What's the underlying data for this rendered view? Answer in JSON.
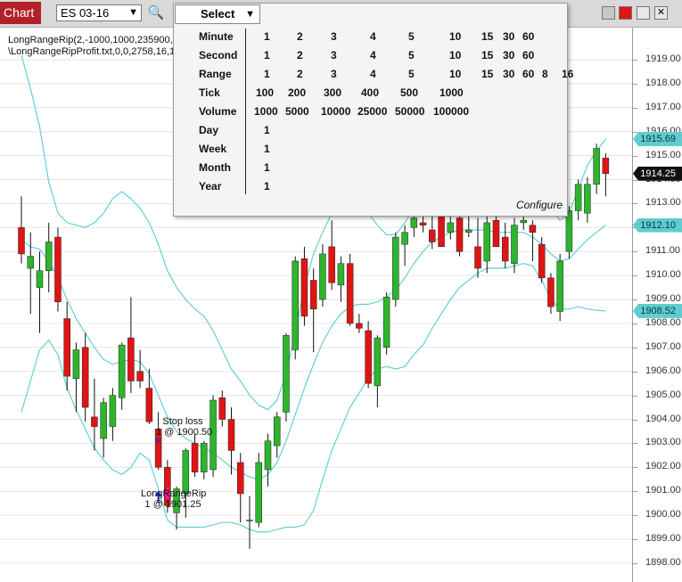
{
  "toolbar": {
    "chart_tab": "Chart",
    "instrument": "ES 03-16",
    "icons": [
      "search-icon",
      "bar-style-icon",
      "pencil-icon",
      "zoom-in-icon",
      "zoom-out-icon",
      "pointer-icon",
      "data-box-icon",
      "properties-icon",
      "strategies-icon",
      "indicators-icon",
      "reload-icon",
      "menu-icon"
    ],
    "window_buttons": [
      "minimize-icon",
      "close-red-icon",
      "maximize-icon",
      "close-icon"
    ],
    "accent": "#b3202a"
  },
  "interval_menu": {
    "select_label": "Select",
    "rows": [
      {
        "label": "Minute",
        "values": [
          "1",
          "2",
          "3",
          "4",
          "5",
          "10",
          "15",
          "30",
          "60"
        ]
      },
      {
        "label": "Second",
        "values": [
          "1",
          "2",
          "3",
          "4",
          "5",
          "10",
          "15",
          "30",
          "60"
        ]
      },
      {
        "label": "Range",
        "values": [
          "1",
          "2",
          "3",
          "4",
          "5",
          "10",
          "15",
          "30",
          "60",
          "8",
          "16"
        ]
      },
      {
        "label": "Tick",
        "values": [
          "100",
          "200",
          "300",
          "400",
          "500",
          "1000"
        ]
      },
      {
        "label": "Volume",
        "values": [
          "1000",
          "5000",
          "10000",
          "25000",
          "50000",
          "100000"
        ]
      },
      {
        "label": "Day",
        "values": [
          "1"
        ]
      },
      {
        "label": "Week",
        "values": [
          "1"
        ]
      },
      {
        "label": "Month",
        "values": [
          "1"
        ]
      },
      {
        "label": "Year",
        "values": [
          "1"
        ]
      }
    ],
    "configure_label": "Configure"
  },
  "chart_labels": {
    "strategy": "LongRangeRip(2,-1000,1000,235900,12",
    "file": "\\LongRangeRipProfit.txt,0,0,2758,16,15",
    "stop_label": "Stop loss",
    "stop_detail": "1 @ 1900.50",
    "entry_label": "LongRangeRip",
    "entry_detail": "1 @ 1901.25"
  },
  "price_axis": {
    "ticks": [
      "1919.00",
      "1918.00",
      "1917.00",
      "1916.00",
      "1915.00",
      "1914.00",
      "1913.00",
      "1912.00",
      "1911.00",
      "1910.00",
      "1909.00",
      "1908.00",
      "1907.00",
      "1906.00",
      "1905.00",
      "1904.00",
      "1903.00",
      "1902.00",
      "1901.00",
      "1900.00",
      "1899.00",
      "1898.00"
    ],
    "tags": [
      {
        "value": "1915.69",
        "price": 1915.69,
        "style": "cyan"
      },
      {
        "value": "1914.25",
        "price": 1914.25,
        "style": "black"
      },
      {
        "value": "1912.10",
        "price": 1912.1,
        "style": "cyan"
      },
      {
        "value": "1908.52",
        "price": 1908.52,
        "style": "cyan"
      }
    ]
  },
  "chart_data": {
    "type": "candlestick",
    "colors": {
      "up": "#2db52d",
      "down": "#e01414",
      "bands": "#66cfd2",
      "entry_arrow": "#1a2fd6",
      "exit_arrow": "#e020d8"
    },
    "ylim": [
      1897.8,
      1919.6
    ],
    "candles": [
      {
        "o": 1912.0,
        "h": 1913.3,
        "l": 1910.5,
        "c": 1910.9
      },
      {
        "o": 1910.3,
        "h": 1911.8,
        "l": 1908.4,
        "c": 1910.8
      },
      {
        "o": 1909.5,
        "h": 1911.0,
        "l": 1907.6,
        "c": 1910.2
      },
      {
        "o": 1910.2,
        "h": 1912.2,
        "l": 1909.3,
        "c": 1911.4
      },
      {
        "o": 1911.6,
        "h": 1912.0,
        "l": 1908.5,
        "c": 1908.9
      },
      {
        "o": 1908.2,
        "h": 1908.9,
        "l": 1905.2,
        "c": 1905.8
      },
      {
        "o": 1905.7,
        "h": 1907.2,
        "l": 1904.3,
        "c": 1906.9
      },
      {
        "o": 1907.0,
        "h": 1907.6,
        "l": 1903.9,
        "c": 1904.5
      },
      {
        "o": 1904.1,
        "h": 1905.7,
        "l": 1902.7,
        "c": 1903.7
      },
      {
        "o": 1903.2,
        "h": 1904.9,
        "l": 1902.4,
        "c": 1904.7
      },
      {
        "o": 1903.7,
        "h": 1905.3,
        "l": 1903.1,
        "c": 1905.0
      },
      {
        "o": 1904.9,
        "h": 1907.2,
        "l": 1904.4,
        "c": 1907.1
      },
      {
        "o": 1907.4,
        "h": 1909.1,
        "l": 1905.1,
        "c": 1905.6
      },
      {
        "o": 1906.0,
        "h": 1906.9,
        "l": 1905.3,
        "c": 1905.6
      },
      {
        "o": 1905.3,
        "h": 1906.1,
        "l": 1903.8,
        "c": 1903.9
      },
      {
        "o": 1903.6,
        "h": 1904.3,
        "l": 1901.9,
        "c": 1902.0
      },
      {
        "o": 1902.0,
        "h": 1902.3,
        "l": 1900.1,
        "c": 1900.4
      },
      {
        "o": 1900.1,
        "h": 1901.2,
        "l": 1899.4,
        "c": 1901.1
      },
      {
        "o": 1900.9,
        "h": 1902.8,
        "l": 1899.9,
        "c": 1902.7
      },
      {
        "o": 1903.0,
        "h": 1903.4,
        "l": 1901.6,
        "c": 1901.8
      },
      {
        "o": 1901.8,
        "h": 1903.1,
        "l": 1901.5,
        "c": 1903.0
      },
      {
        "o": 1901.9,
        "h": 1905.0,
        "l": 1901.6,
        "c": 1904.8
      },
      {
        "o": 1904.9,
        "h": 1905.2,
        "l": 1903.7,
        "c": 1904.0
      },
      {
        "o": 1904.0,
        "h": 1904.5,
        "l": 1901.7,
        "c": 1902.7
      },
      {
        "o": 1902.2,
        "h": 1902.6,
        "l": 1899.7,
        "c": 1900.9
      },
      {
        "o": 1899.8,
        "h": 1900.8,
        "l": 1898.6,
        "c": 1899.8
      },
      {
        "o": 1899.7,
        "h": 1902.6,
        "l": 1899.5,
        "c": 1902.2
      },
      {
        "o": 1901.9,
        "h": 1903.4,
        "l": 1901.2,
        "c": 1903.1
      },
      {
        "o": 1902.9,
        "h": 1904.3,
        "l": 1902.4,
        "c": 1904.1
      },
      {
        "o": 1904.3,
        "h": 1907.6,
        "l": 1903.9,
        "c": 1907.5
      },
      {
        "o": 1906.9,
        "h": 1910.8,
        "l": 1906.5,
        "c": 1910.6
      },
      {
        "o": 1910.7,
        "h": 1911.2,
        "l": 1907.9,
        "c": 1908.3
      },
      {
        "o": 1909.8,
        "h": 1910.3,
        "l": 1906.8,
        "c": 1908.6
      },
      {
        "o": 1909.0,
        "h": 1911.3,
        "l": 1908.7,
        "c": 1910.9
      },
      {
        "o": 1911.2,
        "h": 1912.3,
        "l": 1909.4,
        "c": 1909.7
      },
      {
        "o": 1909.6,
        "h": 1910.8,
        "l": 1908.9,
        "c": 1910.5
      },
      {
        "o": 1910.5,
        "h": 1910.9,
        "l": 1907.9,
        "c": 1908.0
      },
      {
        "o": 1908.0,
        "h": 1908.4,
        "l": 1907.6,
        "c": 1907.8
      },
      {
        "o": 1907.7,
        "h": 1908.1,
        "l": 1905.3,
        "c": 1905.5
      },
      {
        "o": 1905.4,
        "h": 1907.5,
        "l": 1904.5,
        "c": 1907.4
      },
      {
        "o": 1907.0,
        "h": 1909.3,
        "l": 1906.7,
        "c": 1909.1
      },
      {
        "o": 1909.0,
        "h": 1911.8,
        "l": 1908.7,
        "c": 1911.6
      },
      {
        "o": 1911.3,
        "h": 1912.1,
        "l": 1910.4,
        "c": 1911.8
      },
      {
        "o": 1912.0,
        "h": 1913.4,
        "l": 1911.6,
        "c": 1912.4
      },
      {
        "o": 1912.2,
        "h": 1913.1,
        "l": 1911.8,
        "c": 1912.1
      },
      {
        "o": 1911.9,
        "h": 1913.0,
        "l": 1911.1,
        "c": 1911.4
      },
      {
        "o": 1912.6,
        "h": 1913.2,
        "l": 1911.2,
        "c": 1911.2
      },
      {
        "o": 1911.8,
        "h": 1913.6,
        "l": 1911.5,
        "c": 1912.2
      },
      {
        "o": 1912.4,
        "h": 1913.1,
        "l": 1910.8,
        "c": 1911.0
      },
      {
        "o": 1911.8,
        "h": 1913.5,
        "l": 1911.6,
        "c": 1911.9
      },
      {
        "o": 1911.2,
        "h": 1912.4,
        "l": 1909.9,
        "c": 1910.3
      },
      {
        "o": 1910.6,
        "h": 1912.5,
        "l": 1910.1,
        "c": 1912.2
      },
      {
        "o": 1912.3,
        "h": 1912.9,
        "l": 1911.2,
        "c": 1911.2
      },
      {
        "o": 1911.6,
        "h": 1912.2,
        "l": 1910.3,
        "c": 1910.6
      },
      {
        "o": 1910.5,
        "h": 1912.4,
        "l": 1910.1,
        "c": 1912.1
      },
      {
        "o": 1912.2,
        "h": 1913.2,
        "l": 1911.9,
        "c": 1912.3
      },
      {
        "o": 1912.1,
        "h": 1912.3,
        "l": 1910.6,
        "c": 1911.8
      },
      {
        "o": 1911.3,
        "h": 1911.6,
        "l": 1909.7,
        "c": 1909.9
      },
      {
        "o": 1909.9,
        "h": 1910.1,
        "l": 1908.4,
        "c": 1908.7
      },
      {
        "o": 1908.5,
        "h": 1910.9,
        "l": 1908.1,
        "c": 1910.6
      },
      {
        "o": 1911.0,
        "h": 1912.9,
        "l": 1910.7,
        "c": 1912.7
      },
      {
        "o": 1912.7,
        "h": 1914.0,
        "l": 1912.3,
        "c": 1913.8
      },
      {
        "o": 1912.6,
        "h": 1914.1,
        "l": 1912.2,
        "c": 1913.8
      },
      {
        "o": 1913.8,
        "h": 1915.5,
        "l": 1913.4,
        "c": 1915.3
      },
      {
        "o": 1914.9,
        "h": 1915.1,
        "l": 1913.3,
        "c": 1914.25
      }
    ],
    "bands": {
      "upper": [
        1919.2,
        1917.8,
        1916.2,
        1913.9,
        1912.6,
        1912.2,
        1912.1,
        1912.0,
        1912.2,
        1912.6,
        1913.2,
        1913.5,
        1913.2,
        1912.8,
        1912.2,
        1911.3,
        1910.2,
        1909.5,
        1909.0,
        1908.6,
        1908.3,
        1907.7,
        1906.9,
        1906.1,
        1905.6,
        1905.0,
        1904.6,
        1904.4,
        1904.8,
        1905.9,
        1907.6,
        1909.5,
        1910.9,
        1911.8,
        1912.6,
        1913.1,
        1913.3,
        1913.1,
        1912.6,
        1912.1,
        1911.7,
        1911.7,
        1912.2,
        1912.8,
        1913.4,
        1913.9,
        1914.1,
        1914.3,
        1914.3,
        1914.2,
        1914.1,
        1914.0,
        1913.9,
        1913.8,
        1913.8,
        1913.7,
        1913.6,
        1913.3,
        1912.8,
        1912.3,
        1912.6,
        1913.6,
        1914.6,
        1915.2,
        1915.69
      ],
      "lower": [
        1904.3,
        1905.6,
        1906.9,
        1907.3,
        1906.7,
        1905.3,
        1904.4,
        1903.6,
        1902.8,
        1902.3,
        1901.9,
        1901.7,
        1902.0,
        1902.6,
        1902.3,
        1901.1,
        1899.8,
        1899.5,
        1899.5,
        1899.5,
        1899.5,
        1899.6,
        1899.7,
        1899.7,
        1899.6,
        1899.4,
        1899.3,
        1899.3,
        1899.4,
        1899.5,
        1899.5,
        1899.6,
        1900.2,
        1901.5,
        1902.7,
        1903.6,
        1904.5,
        1905.1,
        1905.7,
        1906.1,
        1906.2,
        1906.1,
        1906.2,
        1906.7,
        1907.1,
        1907.8,
        1908.4,
        1909.0,
        1909.5,
        1909.8,
        1910.1,
        1910.3,
        1910.3,
        1910.3,
        1910.4,
        1910.5,
        1910.4,
        1909.8,
        1909.0,
        1908.6,
        1908.6,
        1908.7,
        1908.6,
        1908.55,
        1908.52
      ],
      "middle": [
        1911.5,
        1911.2,
        1911.1,
        1910.6,
        1909.9,
        1909.0,
        1908.2,
        1907.6,
        1907.0,
        1906.5,
        1906.3,
        1906.4,
        1906.5,
        1906.4,
        1905.9,
        1905.0,
        1904.1,
        1903.5,
        1903.2,
        1903.0,
        1902.8,
        1902.6,
        1902.3,
        1902.0,
        1901.8,
        1901.6,
        1901.5,
        1901.7,
        1902.2,
        1903.1,
        1904.2,
        1905.3,
        1906.3,
        1907.2,
        1907.9,
        1908.4,
        1908.7,
        1908.8,
        1908.8,
        1908.9,
        1909.1,
        1909.4,
        1909.9,
        1910.5,
        1911.0,
        1911.4,
        1911.6,
        1911.8,
        1911.9,
        1911.9,
        1911.9,
        1911.9,
        1911.8,
        1911.8,
        1911.8,
        1911.8,
        1911.6,
        1911.3,
        1910.9,
        1910.6,
        1910.7,
        1911.1,
        1911.5,
        1911.8,
        1912.1
      ]
    },
    "markers": [
      {
        "type": "entry",
        "candle": 15,
        "price": 1901.25
      },
      {
        "type": "exit",
        "candle": 16,
        "price": 1900.5
      },
      {
        "type": "stop",
        "candle": 15,
        "price": 1903.2
      }
    ]
  }
}
